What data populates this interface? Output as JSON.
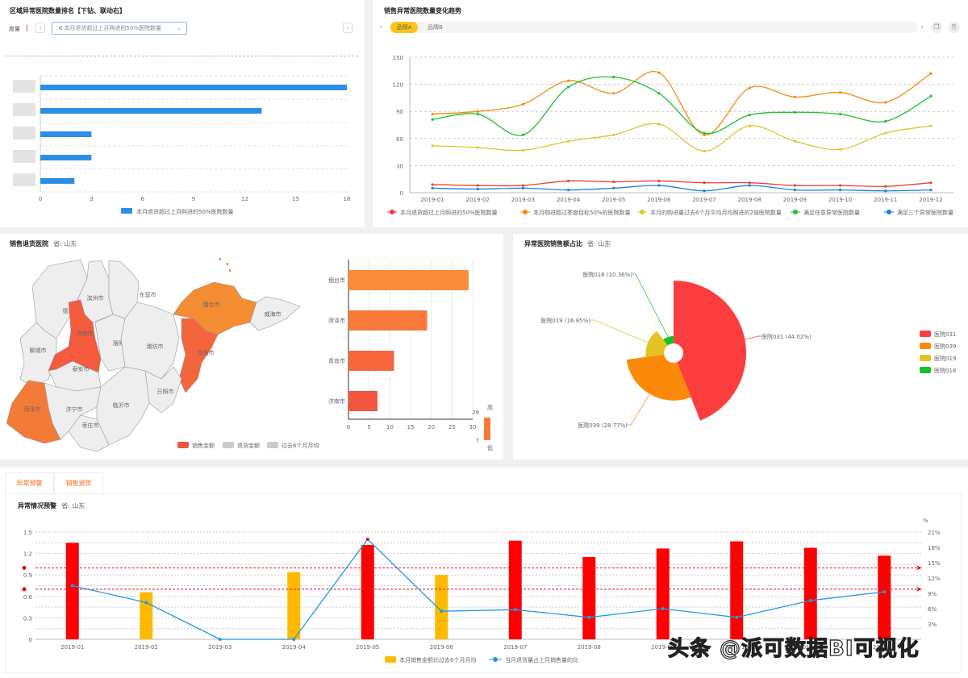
{
  "region_panel": {
    "title": "区域异常医院数量排名【下钻、联动右】",
    "dim_label": "度量",
    "dropdown_value": "本月退货超过上月购进的50%医院数量",
    "prev_icon": "chevron-left-icon",
    "next_icon": "chevron-right-icon"
  },
  "trend_panel": {
    "title": "销售异常医院数量变化趋势",
    "tabs": [
      {
        "label": "品牌A",
        "active": true
      },
      {
        "label": "品牌B",
        "active": false
      }
    ],
    "icons": [
      "copy-icon",
      "export-icon"
    ]
  },
  "map_panel": {
    "title": "销售退货医院",
    "subtitle": "省: 山东",
    "cities": [
      "德州市",
      "滨州市",
      "东营市",
      "聊城市",
      "济南市",
      "淄博市",
      "潍坊市",
      "烟台市",
      "威海市",
      "青岛市",
      "泰安市",
      "日照市",
      "菏泽市",
      "济宁市",
      "临沂市",
      "枣庄市"
    ],
    "highlight": {
      "烟台市": "#f48c32",
      "济南市": "#f45a3e",
      "青岛市": "#f5653c",
      "菏泽市": "#f47a38"
    },
    "legend": [
      {
        "label": "销售金额",
        "color": "#f4553e"
      },
      {
        "label": "退货金额",
        "color": "#cccccc"
      },
      {
        "label": "过去6个月月均",
        "color": "#cccccc"
      }
    ],
    "visual_map": {
      "max": 29,
      "min": 7,
      "high_label": "高",
      "low_label": "低"
    }
  },
  "pie_panel": {
    "title": "异常医院销售额占比",
    "subtitle": "省: 山东"
  },
  "bottom_panel": {
    "tabs": [
      {
        "label": "异常预警",
        "active": true
      },
      {
        "label": "销售退货",
        "active": false
      }
    ],
    "title": "异常情况预警",
    "subtitle": "省: 山东"
  },
  "watermark": "头条 @派可数据BI可视化",
  "chart_data": [
    {
      "type": "bar",
      "orientation": "horizontal",
      "categories": [
        "",
        "",
        "",
        "",
        ""
      ],
      "values": [
        18,
        13,
        3,
        3,
        2
      ],
      "xlim": [
        0,
        18
      ],
      "xticks": [
        0,
        3,
        6,
        9,
        12,
        15,
        18
      ],
      "color": "#2b8fe8",
      "series": [
        {
          "name": "本月退货超过上月购进的50%医院数量"
        }
      ],
      "legend": "bottom",
      "grid": true
    },
    {
      "type": "line",
      "smooth": true,
      "categories": [
        "2019-01",
        "2019-02",
        "2019-03",
        "2019-04",
        "2019-05",
        "2019-06",
        "2019-07",
        "2019-08",
        "2019-09",
        "2019-10",
        "2019-11",
        "2019-12"
      ],
      "ylim": [
        0,
        150
      ],
      "yticks": [
        0,
        30,
        60,
        90,
        120,
        150
      ],
      "legend": "bottom",
      "grid": true,
      "series": [
        {
          "name": "本月退货超过上月购进的50%医院数量",
          "color": "#f03c3c",
          "values": [
            9,
            8,
            8,
            13,
            12,
            13,
            11,
            11,
            8,
            8,
            7,
            11
          ]
        },
        {
          "name": "本月购进超过季度目标50%的医院数量",
          "color": "#f88a0c",
          "values": [
            87,
            90,
            98,
            124,
            110,
            133,
            64,
            116,
            106,
            111,
            100,
            132
          ]
        },
        {
          "name": "本月的购进量过去6个月平均月均购进的2倍医院数量",
          "color": "#e2c42a",
          "values": [
            52,
            50,
            47,
            57,
            64,
            76,
            46,
            74,
            57,
            48,
            66,
            74
          ]
        },
        {
          "name": "满足任意异常医院数量",
          "color": "#1ec22e",
          "values": [
            81,
            87,
            64,
            117,
            128,
            110,
            66,
            86,
            89,
            87,
            79,
            107
          ]
        },
        {
          "name": "满足三个异常医院数量",
          "color": "#1a80dc",
          "values": [
            5,
            4,
            5,
            3,
            5,
            8,
            2,
            8,
            3,
            3,
            2,
            3
          ]
        }
      ]
    },
    {
      "type": "bar",
      "orientation": "horizontal",
      "categories": [
        "烟台市",
        "菏泽市",
        "青岛市",
        "济南市"
      ],
      "values": [
        29,
        19,
        11,
        7
      ],
      "colors": [
        "#fb8c3a",
        "#f77a3b",
        "#f6673d",
        "#f4553e"
      ],
      "xlim": [
        0,
        30
      ],
      "xticks": [
        0,
        5,
        10,
        15,
        20,
        25,
        30
      ],
      "grid": true
    },
    {
      "type": "pie",
      "rose": true,
      "slices": [
        {
          "name": "医院031",
          "value": 44.02,
          "label": "医院031 (44.02%)",
          "color": "#fc3d3d"
        },
        {
          "name": "医院039",
          "value": 28.77,
          "label": "医院039 (28.77%)",
          "color": "#fb8a0a"
        },
        {
          "name": "医院019",
          "value": 16.85,
          "label": "医院019 (16.85%)",
          "color": "#e6c324"
        },
        {
          "name": "医院018",
          "value": 10.36,
          "label": "医院018 (10.36%)",
          "color": "#12c229"
        }
      ],
      "legend": "right"
    },
    {
      "type": "bar+line",
      "categories": [
        "2019-01",
        "2019-02",
        "2019-03",
        "2019-04",
        "2019-05",
        "2019-06",
        "2019-07",
        "2019-08",
        "2019-09",
        "2019-10",
        "2019-11",
        "2019-12"
      ],
      "ylim": [
        0,
        1.5
      ],
      "yticks": [
        "0",
        "0.3",
        "0.6",
        "0.9",
        "1.2",
        "1.5"
      ],
      "y2lim": [
        0,
        21
      ],
      "y2ticks": [
        "3%",
        "6%",
        "9%",
        "12%",
        "15%",
        "18%",
        "21%"
      ],
      "y2unit": "%",
      "bars": {
        "name": "本月销售金额比过去6个月月均",
        "color": "#ffba00",
        "alert_color": "#ff0000",
        "values": [
          1.35,
          0.66,
          0,
          0.94,
          1.32,
          0.9,
          1.38,
          1.15,
          1.27,
          1.37,
          1.28,
          1.17
        ]
      },
      "line": {
        "name": "当月退货量占上月销售量的比",
        "color": "#1e9be8",
        "values": [
          10.5,
          7.2,
          0,
          0,
          19.6,
          5.5,
          5.8,
          4.3,
          6.0,
          4.3,
          7.6,
          9.3
        ]
      },
      "mark_lines": [
        1.0,
        0.7
      ],
      "mark_color": "#e0101a",
      "legend": "bottom",
      "grid": true
    }
  ]
}
